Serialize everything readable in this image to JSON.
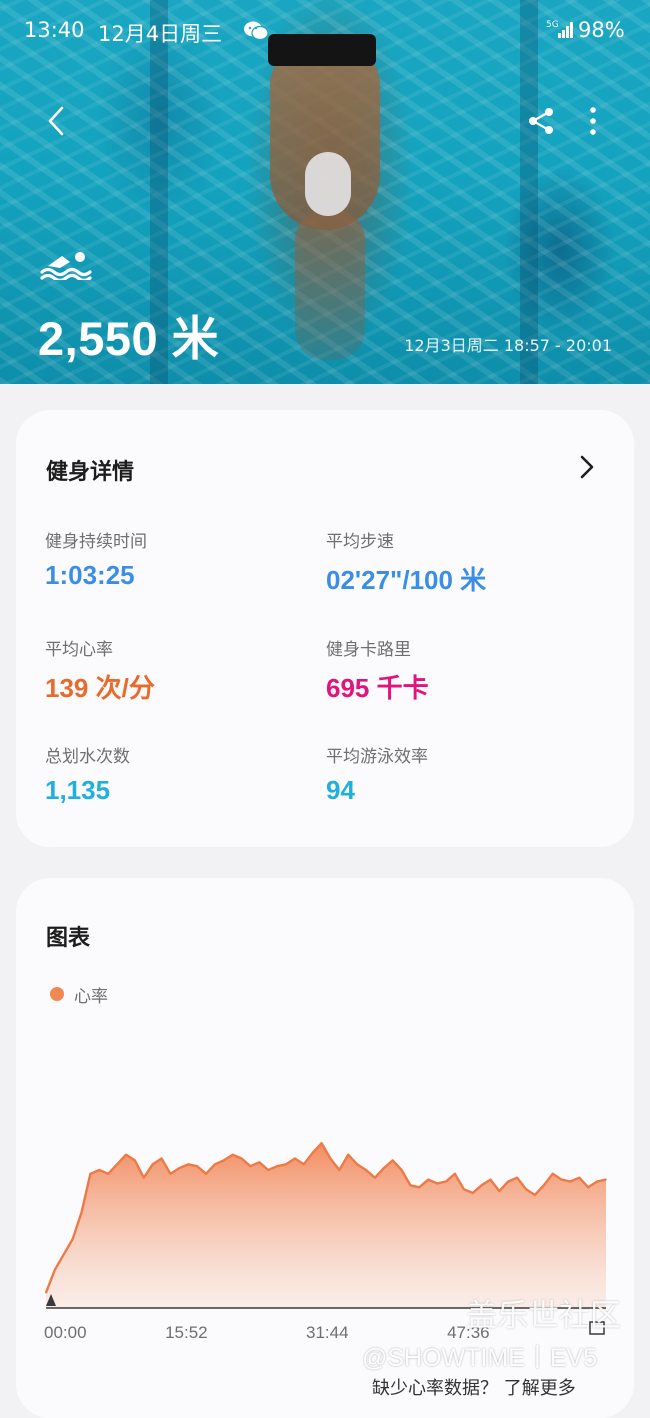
{
  "status_bar": {
    "time": "13:40",
    "date": "12月4日周三",
    "network": "5G",
    "battery": "98%"
  },
  "hero": {
    "distance": "2,550 米",
    "time_range": "12月3日周二 18:57 - 20:01"
  },
  "details": {
    "title": "健身详情",
    "stats": [
      {
        "label": "健身持续时间",
        "value": "1:03:25",
        "color": "#3a8ee6"
      },
      {
        "label": "平均步速",
        "value": "02'27\"/100 米",
        "color": "#3a8ee6"
      },
      {
        "label": "平均心率",
        "value": "139 次/分",
        "color": "#ea6a2c"
      },
      {
        "label": "健身卡路里",
        "value": "695 千卡",
        "color": "#e3127e"
      },
      {
        "label": "总划水次数",
        "value": "1,135",
        "color": "#1fb0e0"
      },
      {
        "label": "平均游泳效率",
        "value": "94",
        "color": "#1fb0e0"
      }
    ]
  },
  "chart_section": {
    "title": "图表",
    "legend": "心率",
    "legend_color": "#f08850"
  },
  "chart_data": {
    "type": "area",
    "series": [
      {
        "name": "心率",
        "x_minutes": [
          0,
          1,
          2,
          3,
          4,
          5,
          6,
          7,
          8,
          9,
          10,
          11,
          12,
          13,
          14,
          15,
          16,
          17,
          18,
          19,
          20,
          21,
          22,
          23,
          24,
          25,
          26,
          27,
          28,
          29,
          30,
          31,
          32,
          33,
          34,
          35,
          36,
          37,
          38,
          39,
          40,
          41,
          42,
          43,
          44,
          45,
          46,
          47,
          48,
          49,
          50,
          51,
          52,
          53,
          54,
          55,
          56,
          57,
          58,
          59,
          60,
          61,
          62,
          63
        ],
        "values": [
          88,
          100,
          108,
          116,
          130,
          150,
          152,
          150,
          155,
          160,
          157,
          148,
          155,
          158,
          150,
          153,
          155,
          154,
          150,
          155,
          157,
          160,
          158,
          154,
          156,
          152,
          154,
          155,
          158,
          155,
          161,
          166,
          158,
          152,
          160,
          155,
          152,
          148,
          153,
          157,
          152,
          144,
          143,
          147,
          145,
          146,
          150,
          142,
          140,
          144,
          147,
          141,
          146,
          148,
          142,
          139,
          144,
          150,
          147,
          146,
          148,
          143,
          146,
          147
        ]
      }
    ],
    "x_ticks": [
      "00:00",
      "15:52",
      "31:44",
      "47:36"
    ],
    "xlim": [
      0,
      63
    ],
    "ylim": [
      80,
      200
    ],
    "grid": false
  },
  "watermark": {
    "line1": "盖乐世社区",
    "line2": "@SHOWTIME丨EV5"
  },
  "footer": {
    "missing_hr_link": "缺少心率数据？ 了解更多"
  }
}
